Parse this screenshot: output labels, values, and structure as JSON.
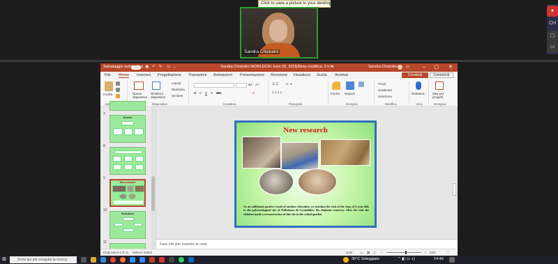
{
  "zoom": {
    "tooltip": "Click to save a picture to your desktop.",
    "participant_name": "Sandra Chistolini",
    "side_labels": [
      "CH"
    ]
  },
  "ppt": {
    "autosave_label": "Salvataggio automatico",
    "autosave_state": "On",
    "doc_title": "Sandra Chistolini WORLDCRI June 20, 2021",
    "last_modified": "Ultima modifica: 2 h fa",
    "user_name": "Sandra Chistolini",
    "share_label": "Condividi",
    "comments_label": "Commenti",
    "tabs": [
      "File",
      "Home",
      "Inserisci",
      "Progettazione",
      "Transizioni",
      "Animazioni",
      "Presentazione",
      "Revisione",
      "Visualizza",
      "Guida",
      "Acrobat"
    ],
    "active_tab": "Home",
    "ribbon": {
      "paste": "Incolla",
      "new_slide": "Nuova diapositiva",
      "reuse_slide": "Riutilizza diapositive",
      "layout": "Layout",
      "reset": "Ripristina",
      "section": "Sezione",
      "shapes": "Forme",
      "arrange": "Disponi",
      "find": "Trova",
      "replace": "Sostituisci",
      "select": "Seleziona",
      "dictation": "Dettatura",
      "designer": "Idee per progetti",
      "groups": [
        "Appunti",
        "Diapositive",
        "Carattere",
        "Paragrafo",
        "Disegno",
        "Modifica",
        "Voce",
        "Designer"
      ]
    },
    "thumbnails": [
      {
        "num": "7",
        "title": "Results"
      },
      {
        "num": "8",
        "title": ""
      },
      {
        "num": "9",
        "title": "New research"
      },
      {
        "num": "10",
        "title": "Evaluation"
      },
      {
        "num": "11",
        "title": ""
      }
    ],
    "selected_thumbnail": "9",
    "slide": {
      "title": "New research",
      "body": "As an additional positive result of outdoor education, we mention the visit of the class of 5-year-olds to the paleontological site of Polledrara di Cecanibbio: the elephant cemetery. After the visit the children made a reconstruction of this site in the school garden."
    },
    "notes_placeholder": "Fare clic per inserire le note",
    "status": {
      "slide_count": "Diapositiva 9 di 11",
      "language": "Italiano (Italia)",
      "notes": "Note",
      "zoom": "53%"
    }
  },
  "taskbar": {
    "search_placeholder": "Scrivi qui per eseguire la ricerca",
    "weather": "30°C  Soleggiato",
    "time": "14:46"
  },
  "colors": {
    "ppt_accent": "#b7472a",
    "slide_border": "#2f6fbf",
    "slide_title": "#d41818",
    "zoom_frame": "#2aa02a"
  }
}
